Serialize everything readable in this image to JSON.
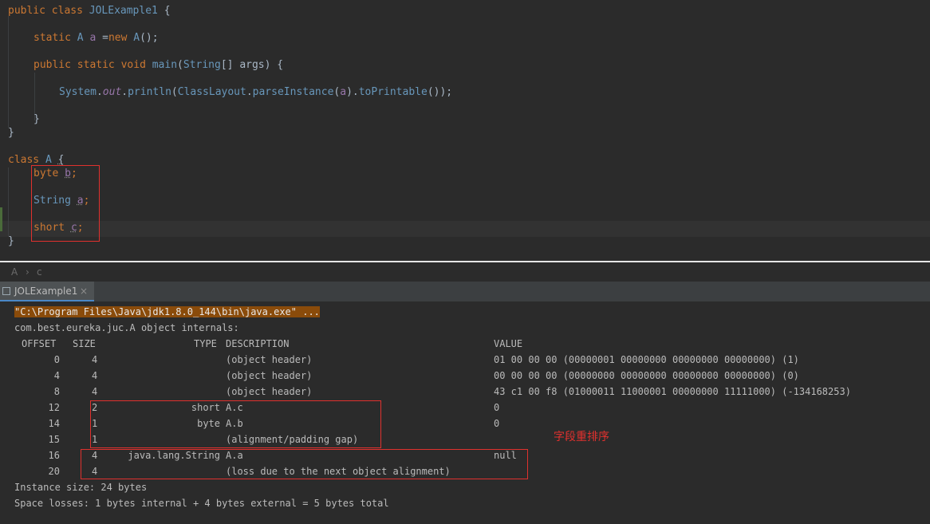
{
  "editor": {
    "code": {
      "l1": {
        "kw1": "public",
        "kw2": "class",
        "name": "JOLExample1",
        "brace": "{"
      },
      "l2": {
        "kw1": "static",
        "type": "A",
        "var": "a",
        "assign": "=",
        "kw2": "new",
        "ctor": "A",
        "rest": "();"
      },
      "l3": {
        "kw1": "public",
        "kw2": "static",
        "kw3": "void",
        "method": "main",
        "paren": "(",
        "type": "String",
        "rest": "[] args) {"
      },
      "l4": {
        "cls": "System",
        "dot1": ".",
        "field": "out",
        "dot2": ".",
        "call": "println",
        "p1": "(",
        "cls2": "ClassLayout",
        "dot3": ".",
        "call2": "parseInstance",
        "p2": "(",
        "arg": "a",
        "p3": ").",
        "call3": "toPrintable",
        "end": "());"
      },
      "l5": {
        "brace": "}"
      },
      "l6": {
        "brace": "}"
      },
      "l7": {
        "kw": "class",
        "name": "A",
        "brace": "{"
      },
      "l8": {
        "type": "byte",
        "name": "b",
        "semi": ";"
      },
      "l9": {
        "type": "String",
        "name": "a",
        "semi": ";"
      },
      "l10": {
        "type": "short",
        "name": "c",
        "semi": ";"
      },
      "l11": {
        "brace": "}"
      }
    }
  },
  "breadcrumb": {
    "class": "A",
    "sep": "›",
    "field": "c"
  },
  "run_tab": {
    "label": "JOLExample1",
    "close": "×"
  },
  "console": {
    "cmd": "\"C:\\Program Files\\Java\\jdk1.8.0_144\\bin\\java.exe\" ...",
    "title": "com.best.eureka.juc.A object internals:",
    "headers": {
      "offset": "OFFSET",
      "size": "SIZE",
      "type": "TYPE",
      "description": "DESCRIPTION",
      "value": "VALUE"
    },
    "rows": [
      {
        "offset": "0",
        "size": "4",
        "type": "",
        "desc": "(object header)",
        "value": "01 00 00 00 (00000001 00000000 00000000 00000000) (1)"
      },
      {
        "offset": "4",
        "size": "4",
        "type": "",
        "desc": "(object header)",
        "value": "00 00 00 00 (00000000 00000000 00000000 00000000) (0)"
      },
      {
        "offset": "8",
        "size": "4",
        "type": "",
        "desc": "(object header)",
        "value": "43 c1 00 f8 (01000011 11000001 00000000 11111000) (-134168253)"
      },
      {
        "offset": "12",
        "size": "2",
        "type": "short",
        "desc": "A.c",
        "value": "0"
      },
      {
        "offset": "14",
        "size": "1",
        "type": "byte",
        "desc": "A.b",
        "value": "0"
      },
      {
        "offset": "15",
        "size": "1",
        "type": "",
        "desc": "(alignment/padding gap)",
        "value": ""
      },
      {
        "offset": "16",
        "size": "4",
        "type": "java.lang.String",
        "desc": "A.a",
        "value": "null"
      },
      {
        "offset": "20",
        "size": "4",
        "type": "",
        "desc": "(loss due to the next object alignment)",
        "value": ""
      }
    ],
    "instance_size": "Instance size: 24 bytes",
    "space_losses": "Space losses: 1 bytes internal + 4 bytes external = 5 bytes total"
  },
  "annotation": "字段重排序",
  "colors": {
    "keyword": "#cc7832",
    "type": "#6897bb",
    "field": "#9876aa",
    "highlight_box": "#e0312e",
    "cmd_bg": "#8a4b0a"
  }
}
